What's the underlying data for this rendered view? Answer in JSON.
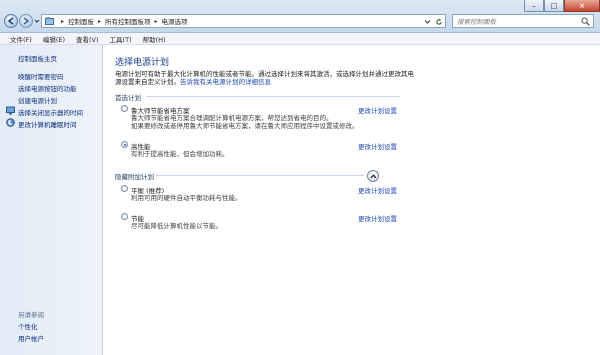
{
  "address": {
    "breadcrumbs": [
      "控制面板",
      "所有控制面板项",
      "电源选项"
    ],
    "search_placeholder": "搜索控制面板"
  },
  "menu": [
    "文件(F)",
    "编辑(E)",
    "查看(V)",
    "工具(T)",
    "帮助(H)"
  ],
  "sidebar": {
    "home": "控制面板主页",
    "links": [
      "唤醒时需要密码",
      "选择电源按钮的功能",
      "创建电源计划",
      "选择关闭显示器的时间",
      "更改计算机睡眠时间"
    ],
    "see_also_title": "另请参阅",
    "see_also": [
      "个性化",
      "用户帐户"
    ]
  },
  "main": {
    "title": "选择电源计划",
    "intro": "电源计划可有助于最大化计算机的性能或者节能。通过选择计划来将其激活，或选择计划并通过更改其电源设置来自定义计划。",
    "intro_link": "告诉我有关电源计划的详细信息",
    "preferred_title": "首选计划",
    "hidden_title": "隐藏附加计划",
    "change_label": "更改计划设置",
    "plans": [
      {
        "name": "鲁大师节能省电方案",
        "desc1": "鲁大师节能省电方案合理调配计算机电源方案，帮您达到省电的目的。",
        "desc2": "如果要修改或者停用鲁大师节能省电方案，请在鲁大师应用程序中设置或修改。",
        "selected": false
      },
      {
        "name": "高性能",
        "desc1": "有利于提高性能，但会增加功耗。",
        "selected": true
      },
      {
        "name": "平衡 (推荐)",
        "desc1": "利用可用的硬件自动平衡功耗与性能。",
        "selected": false
      },
      {
        "name": "节能",
        "desc1": "尽可能降低计算机性能以节能。",
        "selected": false
      }
    ]
  },
  "colors": {
    "link": "#1a46b0",
    "title": "#1b3d8f",
    "sidebar_bg": "#e2ebf6"
  }
}
